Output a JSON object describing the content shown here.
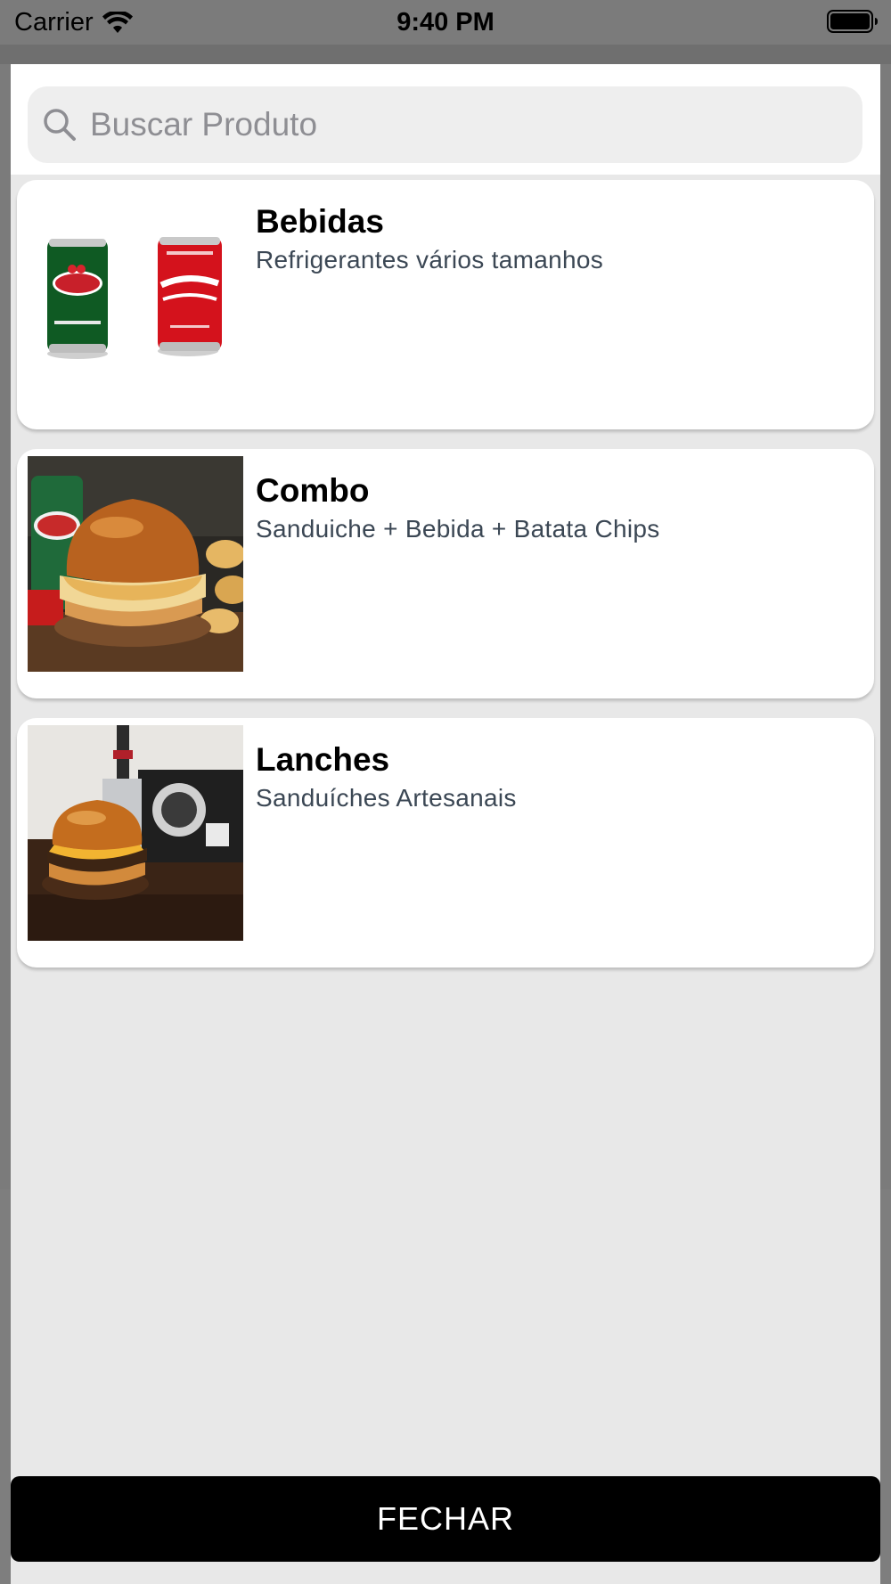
{
  "status_bar": {
    "carrier": "Carrier",
    "time": "9:40 PM"
  },
  "search": {
    "placeholder": "Buscar Produto",
    "value": ""
  },
  "categories": [
    {
      "title": "Bebidas",
      "subtitle": "Refrigerantes vários tamanhos",
      "image": "soda-cans-image"
    },
    {
      "title": "Combo",
      "subtitle": "Sanduiche + Bebida + Batata Chips",
      "image": "burger-combo-image"
    },
    {
      "title": "Lanches",
      "subtitle": "Sanduíches Artesanais",
      "image": "burger-knife-image"
    }
  ],
  "footer": {
    "close_label": "FECHAR"
  },
  "colors": {
    "sheet_background": "#e8e8e8",
    "card_background": "#ffffff",
    "button_background": "#000000",
    "subtitle_text": "#3b4754"
  }
}
